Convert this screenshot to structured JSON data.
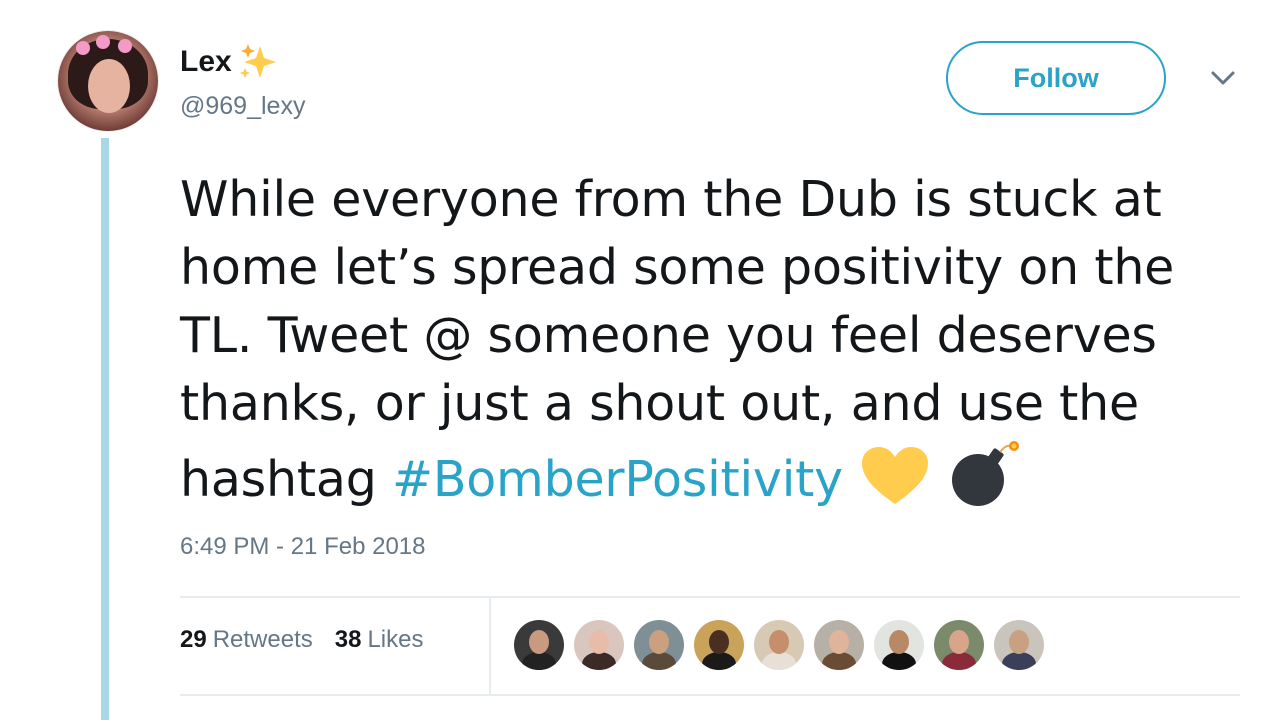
{
  "user": {
    "display_name": "Lex",
    "handle": "@969_lexy",
    "avatar_icon": "profile-photo"
  },
  "actions": {
    "follow_label": "Follow",
    "menu_icon": "chevron-down-icon"
  },
  "tweet": {
    "lines": [
      "While everyone from the Dub is stuck at",
      "home let’s spread some positivity on the",
      "TL. Tweet @ someone you feel deserves",
      "thanks, or just a shout out,  and use the"
    ],
    "last_line_prefix": "hashtag ",
    "hashtag": "#BomberPositivity",
    "emojis": [
      "yellow-heart-icon",
      "bomb-icon"
    ],
    "timestamp": "6:49 PM - 21 Feb 2018"
  },
  "stats": {
    "retweets_count": "29",
    "retweets_label": "Retweets",
    "likes_count": "38",
    "likes_label": "Likes"
  },
  "likers": [
    {
      "bg": "#3a3a3a",
      "skin": "#c89a80",
      "shirt": "#222222"
    },
    {
      "bg": "#d9c7bf",
      "skin": "#e7bca8",
      "shirt": "#3b2a26"
    },
    {
      "bg": "#7e8f96",
      "skin": "#caa07f",
      "shirt": "#5a4a3a"
    },
    {
      "bg": "#c9a35a",
      "skin": "#4a2e22",
      "shirt": "#1a1a1a"
    },
    {
      "bg": "#d8c9b5",
      "skin": "#c68f6c",
      "shirt": "#e8e0d6"
    },
    {
      "bg": "#b7b0a6",
      "skin": "#e0b49a",
      "shirt": "#6a4b34"
    },
    {
      "bg": "#e2e4df",
      "skin": "#b98967",
      "shirt": "#111111"
    },
    {
      "bg": "#7a8a6a",
      "skin": "#d9a58a",
      "shirt": "#8a2b3a"
    },
    {
      "bg": "#c9c4bc",
      "skin": "#caa083",
      "shirt": "#3a3f5a"
    }
  ],
  "colors": {
    "accent": "#2aa3c8",
    "thread_line": "#a8d8e8",
    "secondary_text": "#657786",
    "heart": "#ffcc4d",
    "bomb": "#31373d"
  }
}
